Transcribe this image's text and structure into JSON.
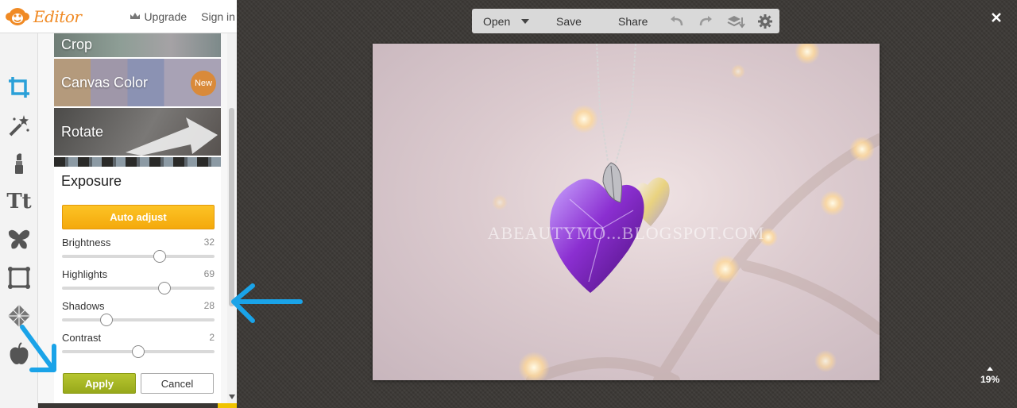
{
  "app": {
    "title": "Editor"
  },
  "header": {
    "upgrade_label": "Upgrade",
    "signin_label": "Sign in"
  },
  "rail": {
    "tools": [
      {
        "icon": "crop-icon"
      },
      {
        "icon": "magic-wand-icon"
      },
      {
        "icon": "lipstick-icon"
      },
      {
        "icon": "text-icon",
        "label": "Tt"
      },
      {
        "icon": "butterfly-icon"
      },
      {
        "icon": "frame-icon"
      },
      {
        "icon": "texture-icon"
      },
      {
        "icon": "apple-icon"
      }
    ]
  },
  "menu": {
    "tiles": [
      {
        "label": "Crop"
      },
      {
        "label": "Canvas Color",
        "badge": "New"
      },
      {
        "label": "Rotate"
      }
    ]
  },
  "exposure": {
    "title": "Exposure",
    "auto_adjust_label": "Auto adjust",
    "sliders": [
      {
        "label": "Brightness",
        "value": "32",
        "level": 0.64
      },
      {
        "label": "Highlights",
        "value": "69",
        "level": 0.67
      },
      {
        "label": "Shadows",
        "value": "28",
        "level": 0.29
      },
      {
        "label": "Contrast",
        "value": "2",
        "level": 0.5
      }
    ],
    "apply_label": "Apply",
    "cancel_label": "Cancel"
  },
  "toolbar": {
    "open_label": "Open",
    "save_label": "Save",
    "share_label": "Share"
  },
  "zoom": {
    "level": "19%"
  },
  "photo": {
    "watermark": "ABEAUTYMO...BLOGSPOT.COM"
  },
  "colors": {
    "accent": "#f4a90c",
    "apply": "#a4b521",
    "annotation": "#1aa3e8",
    "brand": "#f08a24"
  }
}
